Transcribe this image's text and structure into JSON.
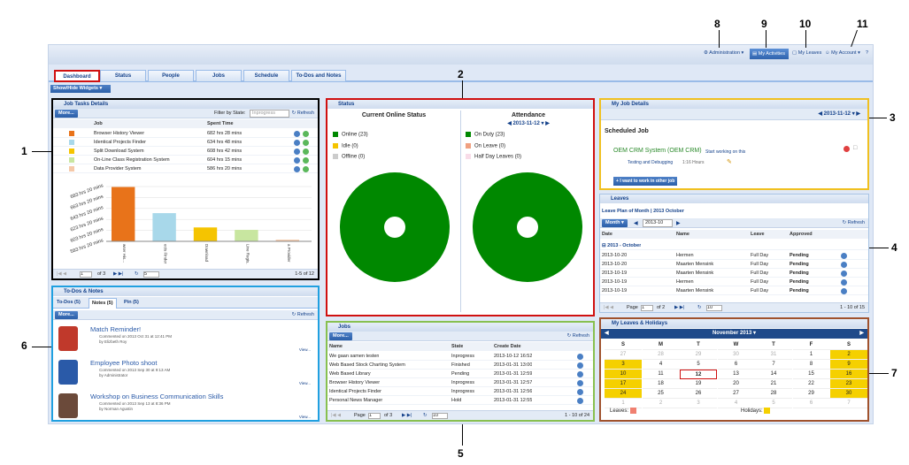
{
  "callouts": [
    "1",
    "2",
    "3",
    "4",
    "5",
    "6",
    "7",
    "8",
    "9",
    "10",
    "11"
  ],
  "topbar": {
    "administration": "Administration",
    "my_activities": "My Activities",
    "my_leaves": "My Leaves",
    "my_account": "My Account",
    "help": "?"
  },
  "tabs": [
    "Dashboard",
    "Status",
    "People",
    "Jobs",
    "Schedule",
    "To-Dos and Notes"
  ],
  "widgets_button": "Show/Hide Widgets",
  "job_tasks": {
    "title": "Job Tasks Details",
    "more": "More...",
    "filter_label": "Filter by State:",
    "filter_value": "Inprogress",
    "refresh": "Refresh",
    "col_job": "Job",
    "col_spent": "Spent Time",
    "rows": [
      {
        "job": "Browser History Viewer",
        "spent": "682 hrs 28 mins",
        "color": "#e8731a"
      },
      {
        "job": "Identical Projects Finder",
        "spent": "634 hrs 48 mins",
        "color": "#a8d8ea"
      },
      {
        "job": "Split Download System",
        "spent": "608 hrs 42 mins",
        "color": "#f5c400"
      },
      {
        "job": "On-Line Class Registration System",
        "spent": "604 hrs 15 mins",
        "color": "#c8e6a0"
      },
      {
        "job": "Data Provider System",
        "spent": "586 hrs 20 mins",
        "color": "#f5c8a8"
      }
    ],
    "page": "1",
    "of": "of 3",
    "page_size": "5",
    "count": "1-5 of 12"
  },
  "chart_data": {
    "type": "bar",
    "categories": [
      "Browser History Viewer",
      "Identical Projects Finder",
      "Split Download System",
      "On-Line Class Registration System",
      "Data Provider System"
    ],
    "tick_labels": [
      "wser His...",
      "ects Finder",
      "Download",
      "Line Regis...",
      "a Provider"
    ],
    "values": [
      682.47,
      634.8,
      608.7,
      604.25,
      586.33
    ],
    "y_ticks": [
      "683 hrs 20 mins",
      "663 hrs 20 mins",
      "643 hrs 20 mins",
      "623 hrs 20 mins",
      "603 hrs 20 mins",
      "583 hrs 20 mins"
    ],
    "ylim": [
      583.33,
      683.33
    ],
    "colors": [
      "#e8731a",
      "#a8d8ea",
      "#f5c400",
      "#c8e6a0",
      "#f5c8a8"
    ]
  },
  "status": {
    "title": "Status",
    "left_title": "Current Online Status",
    "left_legend": [
      {
        "label": "Online (23)",
        "color": "#008800"
      },
      {
        "label": "Idle (0)",
        "color": "#f5c400"
      },
      {
        "label": "Offline (0)",
        "color": "#cccccc"
      }
    ],
    "right_title": "Attendance",
    "right_date": "2013-11-12",
    "right_legend": [
      {
        "label": "On Duty (23)",
        "color": "#008800"
      },
      {
        "label": "On Leave (0)",
        "color": "#f0a080"
      },
      {
        "label": "Half Day Leaves (0)",
        "color": "#f8dce8"
      }
    ]
  },
  "my_job": {
    "title": "My Job Details",
    "date": "2013-11-12",
    "scheduled": "Scheduled Job",
    "job_name": "OEM CRM System (OEM CRM)",
    "start_link": "Start working on this",
    "task": "Testing and Debugging",
    "hours": "1:16 Hours",
    "other_btn": "I want to work in other job"
  },
  "leaves": {
    "title": "Leaves",
    "subtitle": "Leave Plan of Month | 2013 October",
    "mode": "Month",
    "month": "2013-10",
    "refresh": "Refresh",
    "cols": [
      "Date",
      "Name",
      "Leave",
      "Approved"
    ],
    "group": "2013 - October",
    "rows": [
      {
        "date": "2013-10-20",
        "name": "Hermen",
        "leave": "Full Day",
        "approved": "Pending"
      },
      {
        "date": "2013-10-20",
        "name": "Maarten Mensink",
        "leave": "Full Day",
        "approved": "Pending"
      },
      {
        "date": "2013-10-19",
        "name": "Maarten Mensink",
        "leave": "Full Day",
        "approved": "Pending"
      },
      {
        "date": "2013-10-19",
        "name": "Hermen",
        "leave": "Full Day",
        "approved": "Pending"
      },
      {
        "date": "2013-10-19",
        "name": "Maarten Mensink",
        "leave": "Full Day",
        "approved": "Pending"
      }
    ],
    "page": "1",
    "of": "of 2",
    "page_size": "10",
    "count": "1 - 10 of 15"
  },
  "todos": {
    "title": "To-Dos & Notes",
    "tabs": [
      "To-Dos (5)",
      "Notes (5)",
      "Pin (5)"
    ],
    "more": "More...",
    "refresh": "Refresh",
    "view": "View...",
    "notes": [
      {
        "title": "Match Reminder!",
        "meta": "Commented on 2013 Oct 31 at 12:41 PM",
        "by": "by Elizbeth Roy"
      },
      {
        "title": "Employee Photo shoot",
        "meta": "Commented on 2013 Sep 30 at 9:13 AM",
        "by": "by Administrator"
      },
      {
        "title": "Workshop on Business Communication Skills",
        "meta": "Commented on 2013 Sep 13 at 8:36 PM",
        "by": "by Norman Agustin"
      }
    ]
  },
  "jobs": {
    "title": "Jobs",
    "more": "More...",
    "refresh": "Refresh",
    "cols": [
      "Name",
      "State",
      "Create Date"
    ],
    "rows": [
      {
        "name": "We gaan samen testen",
        "state": "Inprogress",
        "date": "2013-10-12 16:52"
      },
      {
        "name": "Web Based Stock Charting System",
        "state": "Finished",
        "date": "2013-01-31 13:00"
      },
      {
        "name": "Web Based Library",
        "state": "Pending",
        "date": "2013-01-31 12:59"
      },
      {
        "name": "Browser History Viewer",
        "state": "Inprogress",
        "date": "2013-01-31 12:57"
      },
      {
        "name": "Identical Projects Finder",
        "state": "Inprogress",
        "date": "2013-01-31 12:56"
      },
      {
        "name": "Personal News Manager",
        "state": "Hold",
        "date": "2013-01-31 12:55"
      }
    ],
    "page": "1",
    "of": "of 3",
    "page_size": "10",
    "count": "1 - 10 of 24"
  },
  "calendar": {
    "title": "My Leaves & Holidays",
    "month": "November 2013",
    "days": [
      "S",
      "M",
      "T",
      "W",
      "T",
      "F",
      "S"
    ],
    "weeks": [
      [
        "27",
        "28",
        "29",
        "30",
        "31",
        "1",
        "2"
      ],
      [
        "3",
        "4",
        "5",
        "6",
        "7",
        "8",
        "9"
      ],
      [
        "10",
        "11",
        "12",
        "13",
        "14",
        "15",
        "16"
      ],
      [
        "17",
        "18",
        "19",
        "20",
        "21",
        "22",
        "23"
      ],
      [
        "24",
        "25",
        "26",
        "27",
        "28",
        "29",
        "30"
      ],
      [
        "1",
        "2",
        "3",
        "4",
        "5",
        "6",
        "7"
      ]
    ],
    "leaves_label": "Leaves:",
    "holidays_label": "Holidays:"
  }
}
